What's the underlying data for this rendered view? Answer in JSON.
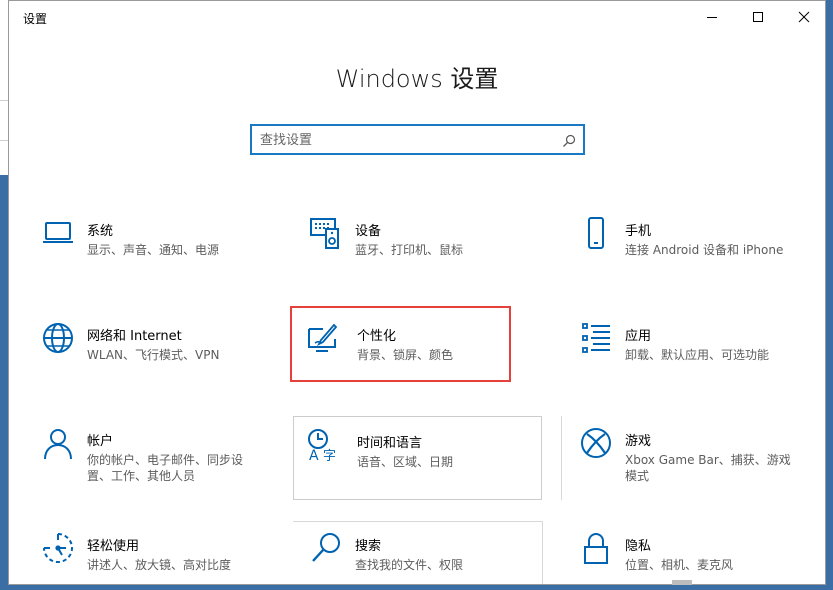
{
  "window": {
    "title": "设置"
  },
  "heading": "Windows 设置",
  "search": {
    "placeholder": "查找设置"
  },
  "tiles": [
    {
      "title": "系统",
      "desc": "显示、声音、通知、电源",
      "icon": "laptop-icon"
    },
    {
      "title": "设备",
      "desc": "蓝牙、打印机、鼠标",
      "icon": "devices-icon"
    },
    {
      "title": "手机",
      "desc": "连接 Android 设备和 iPhone",
      "icon": "phone-icon"
    },
    {
      "title": "网络和 Internet",
      "desc": "WLAN、飞行模式、VPN",
      "icon": "globe-icon"
    },
    {
      "title": "个性化",
      "desc": "背景、锁屏、颜色",
      "icon": "personalization-icon"
    },
    {
      "title": "应用",
      "desc": "卸载、默认应用、可选功能",
      "icon": "apps-list-icon"
    },
    {
      "title": "帐户",
      "desc": "你的帐户、电子邮件、同步设置、工作、其他人员",
      "icon": "person-icon"
    },
    {
      "title": "时间和语言",
      "desc": "语音、区域、日期",
      "icon": "time-language-icon"
    },
    {
      "title": "游戏",
      "desc": "Xbox Game Bar、捕获、游戏模式",
      "icon": "xbox-icon"
    },
    {
      "title": "轻松使用",
      "desc": "讲述人、放大镜、高对比度",
      "icon": "ease-of-access-icon"
    },
    {
      "title": "搜索",
      "desc": "查找我的文件、权限",
      "icon": "search-icon"
    },
    {
      "title": "隐私",
      "desc": "位置、相机、麦克风",
      "icon": "lock-icon"
    }
  ],
  "colors": {
    "accent": "#0063b1",
    "highlight": "#e5413a",
    "search_border": "#1979c3"
  }
}
